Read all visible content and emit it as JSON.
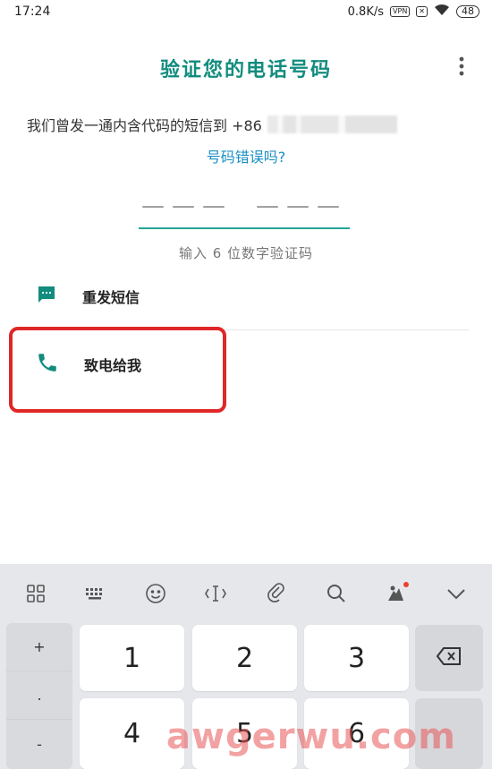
{
  "status_bar": {
    "time": "17:24",
    "speed": "0.8K/s",
    "vpn_label": "VPN",
    "sim_label": "✕",
    "battery": "48"
  },
  "header": {
    "title": "验证您的电话号码",
    "menu_icon": "more-vert-icon"
  },
  "verification": {
    "description": "我们曾发一通内含代码的短信到 +86",
    "wrong_number_link": "号码错误吗?",
    "code_placeholder_left": "———",
    "code_placeholder_right": "———",
    "hint": "输入 6 位数字验证码"
  },
  "options": {
    "resend_sms": {
      "label": "重发短信",
      "icon": "message-icon"
    },
    "call_me": {
      "label": "致电给我",
      "icon": "phone-icon"
    }
  },
  "colors": {
    "accent": "#128C7E",
    "link": "#1a8fc4",
    "highlight": "#e02727",
    "underline": "#25a69a"
  },
  "keyboard": {
    "toolbar": [
      "grid-icon",
      "keyboard-icon",
      "emoji-icon",
      "cursor-icon",
      "clipboard-icon",
      "search-icon",
      "settings-icon",
      "chevron-down-icon"
    ],
    "side_keys": [
      "+",
      ".",
      "-"
    ],
    "keys": [
      "1",
      "2",
      "3",
      "4",
      "5",
      "6"
    ]
  },
  "watermark": "awgerwu.com"
}
